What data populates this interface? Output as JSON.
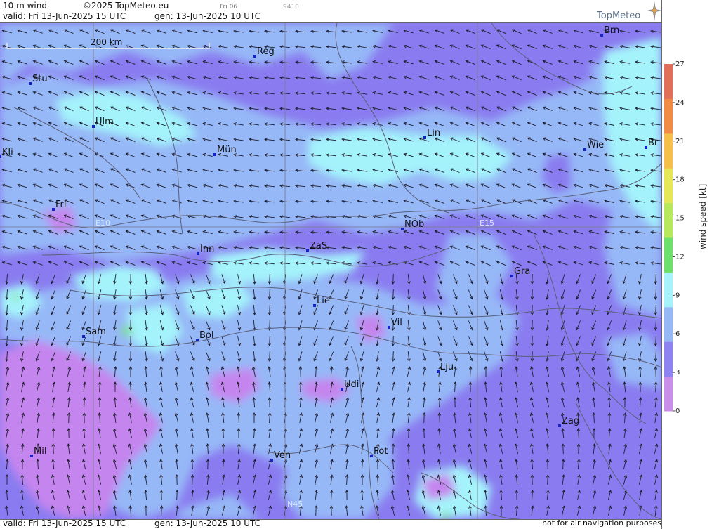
{
  "header": {
    "title": "10 m wind",
    "copyright": "©2025 TopMeteo.eu",
    "small_label": "Fri 06",
    "code": "9410",
    "valid": "valid:  Fri  13-Jun-2025  15 UTC",
    "gen": "gen: 13-Jun-2025 10 UTC",
    "logo": "TopMeteo"
  },
  "footer": {
    "valid": "valid:  Fri  13-Jun-2025  15 UTC",
    "gen": "gen: 13-Jun-2025 10 UTC",
    "note": "not for air navigation purposes"
  },
  "map": {
    "scale_label": "200 km",
    "grid_labels": [
      "E10",
      "E15",
      "N45"
    ],
    "cities": [
      {
        "name": "Brn"
      },
      {
        "name": "Reg"
      },
      {
        "name": "Stu"
      },
      {
        "name": "Ulm"
      },
      {
        "name": "Lin"
      },
      {
        "name": "Wie"
      },
      {
        "name": "Br"
      },
      {
        "name": "Kli"
      },
      {
        "name": "Mün"
      },
      {
        "name": "Fri"
      },
      {
        "name": "NÖb"
      },
      {
        "name": "Inn"
      },
      {
        "name": "ZaS"
      },
      {
        "name": "Gra"
      },
      {
        "name": "Lie"
      },
      {
        "name": "Vil"
      },
      {
        "name": "Sam"
      },
      {
        "name": "Bol"
      },
      {
        "name": "Lju"
      },
      {
        "name": "Udi"
      },
      {
        "name": "Zag"
      },
      {
        "name": "Mil"
      },
      {
        "name": "Ven"
      },
      {
        "name": "Pot"
      }
    ],
    "colors": {
      "base_purple": "#8a7cf0",
      "blue": "#96b8f7",
      "cyan": "#a4f3fb",
      "magenta": "#c585ee",
      "green": "#78e07a"
    }
  },
  "legend": {
    "title": "wind  speed  [kt]",
    "ticks": [
      "27",
      "24",
      "21",
      "18",
      "15",
      "12",
      "9",
      "6",
      "3",
      "0"
    ],
    "colors": [
      "#c98ee8",
      "#8f82f2",
      "#96b8f5",
      "#a6f2fb",
      "#6de06b",
      "#b8e85c",
      "#e6e85a",
      "#f5c04a",
      "#f08c46",
      "#e0705a"
    ]
  }
}
